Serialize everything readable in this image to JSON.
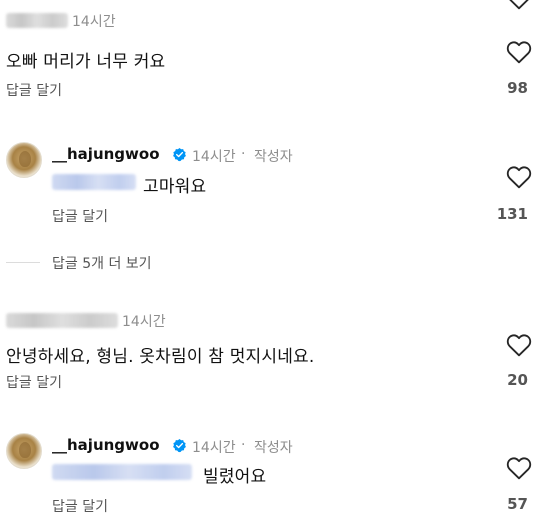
{
  "comments": [
    {
      "username_masked": true,
      "time": "14시간",
      "text": "오빠 머리가 너무 커요",
      "reply_label": "답글 달기",
      "like_count": "98"
    },
    {
      "username": "__hajungwoo",
      "time": "14시간",
      "separator": "·",
      "author_tag": "작성자",
      "mention_masked": true,
      "text": "고마워요",
      "reply_label": "답글 달기",
      "like_count": "131"
    },
    {
      "username_masked": true,
      "time": "14시간",
      "text": "안녕하세요, 형님. 옷차림이 참 멋지시네요.",
      "reply_label": "답글 달기",
      "like_count": "20"
    },
    {
      "username": "__hajungwoo",
      "time": "14시간",
      "separator": "·",
      "author_tag": "작성자",
      "mention_masked": true,
      "text": "빌렸어요",
      "reply_label": "답글 달기",
      "like_count": "57"
    }
  ],
  "view_replies_label": "답글 5개 더 보기",
  "icons": {
    "like": "heart-outline-icon",
    "verified": "verified-badge-icon",
    "avatar": "profile-avatar"
  },
  "colors": {
    "verified_blue": "#0095f6",
    "muted_text": "#8e8e8e",
    "mention_blur": "#b6c6ec"
  }
}
